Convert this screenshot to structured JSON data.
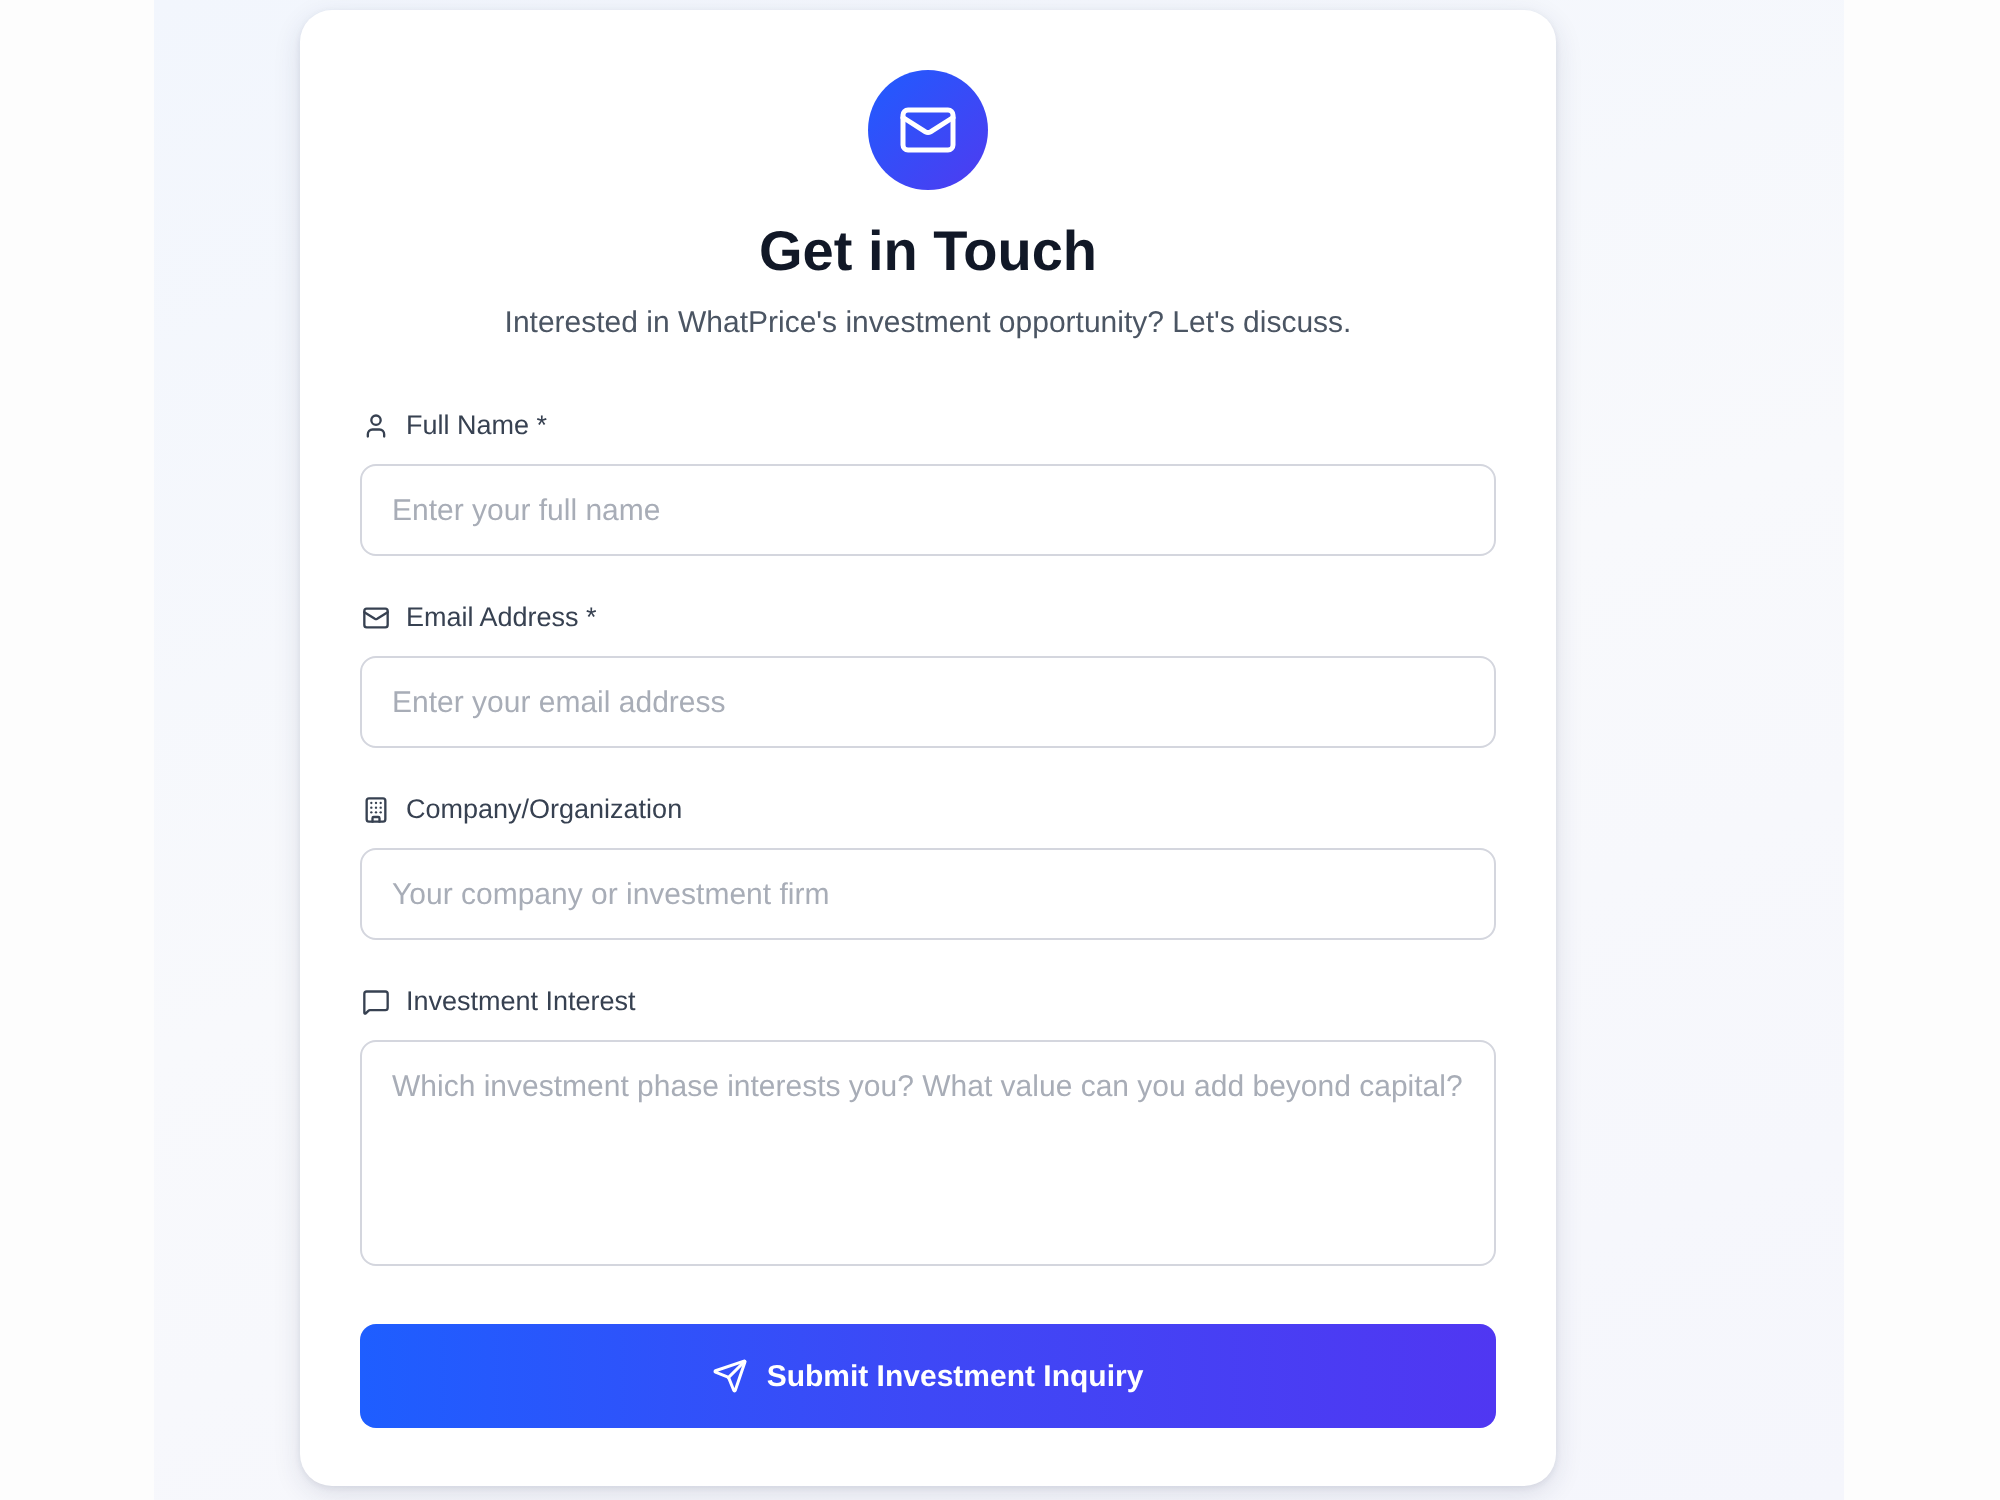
{
  "header": {
    "title": "Get in Touch",
    "subtitle": "Interested in WhatPrice's investment opportunity? Let's discuss."
  },
  "fields": [
    {
      "kind": "input",
      "label": "Full Name *",
      "placeholder": "Enter your full name"
    },
    {
      "kind": "input",
      "label": "Email Address *",
      "placeholder": "Enter your email address"
    },
    {
      "kind": "input",
      "label": "Company/Organization",
      "placeholder": "Your company or investment firm"
    },
    {
      "kind": "textarea",
      "label": "Investment Interest",
      "placeholder": "Which investment phase interests you? What value can you add beyond capital?"
    }
  ],
  "submit": {
    "label": "Submit Investment Inquiry"
  }
}
